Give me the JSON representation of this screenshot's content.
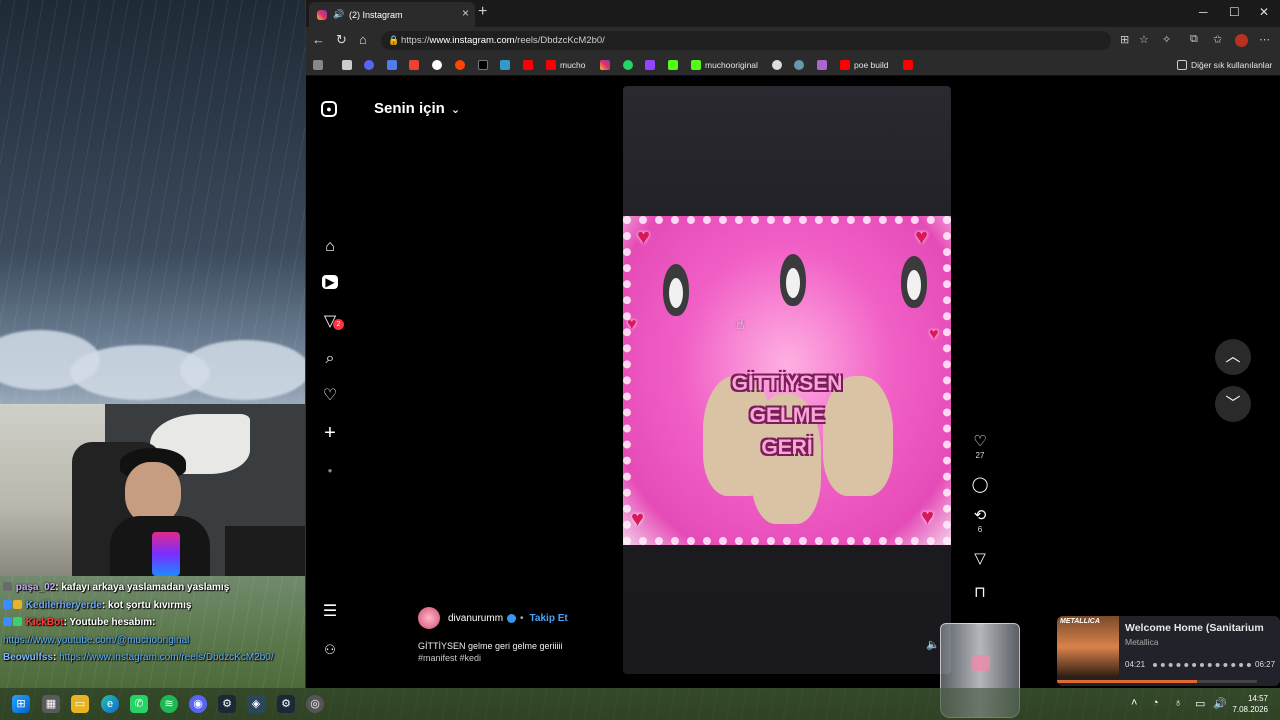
{
  "browser": {
    "tab_title": "(2) Instagram",
    "url_prefix": "https://",
    "url_host": "www.instagram.com",
    "url_path": "/reels/DbdzcKcM2b0/",
    "bookmarks": [
      "mucho",
      "muchooriginal",
      "poe build"
    ],
    "other_bookmarks": "Diğer sık kullanılanlar"
  },
  "instagram": {
    "feed_title": "Senin için",
    "notification_count": "2",
    "reel": {
      "overlay_text": [
        "GİTTİYSEN",
        "GELME",
        "GERİ"
      ],
      "author": "divanurumm",
      "follow_label": "Takip Et",
      "caption": "GİTTİYSEN gelme geri gelme geriiiii",
      "hashtags": "#manifest #kedi",
      "likes": "27",
      "reposts": "6"
    }
  },
  "chat": [
    {
      "user": "paşa_02",
      "user_color": "#c9a7ff",
      "message": ": kafayı arkaya yaslamadan yaslamış"
    },
    {
      "user": "Kedilerheryerde",
      "user_color": "#6fa6ff",
      "message": ": kot şortu kıvırmış"
    },
    {
      "user": "KickBot",
      "user_color": "#ff3b3b",
      "message": ": Youtube hesabım:"
    },
    {
      "user": "",
      "user_color": "#ffffff",
      "message": "https://www.youtube.com/@muchooriginal",
      "is_link": true
    },
    {
      "user": "Beowulfss",
      "user_color": "#7eb6ff",
      "message": ": ",
      "link": "https://www.instagram.com/reels/DbdzcKcM2b0/"
    }
  ],
  "music": {
    "title": "Welcome Home (Sanitarium",
    "artist": "Metallica",
    "elapsed": "04:21",
    "duration": "06:27",
    "album_text": "METALLICA",
    "progress": 0.67,
    "volume": 0.7
  },
  "taskbar": {
    "time": "14:57",
    "date": "7.08.2026"
  }
}
